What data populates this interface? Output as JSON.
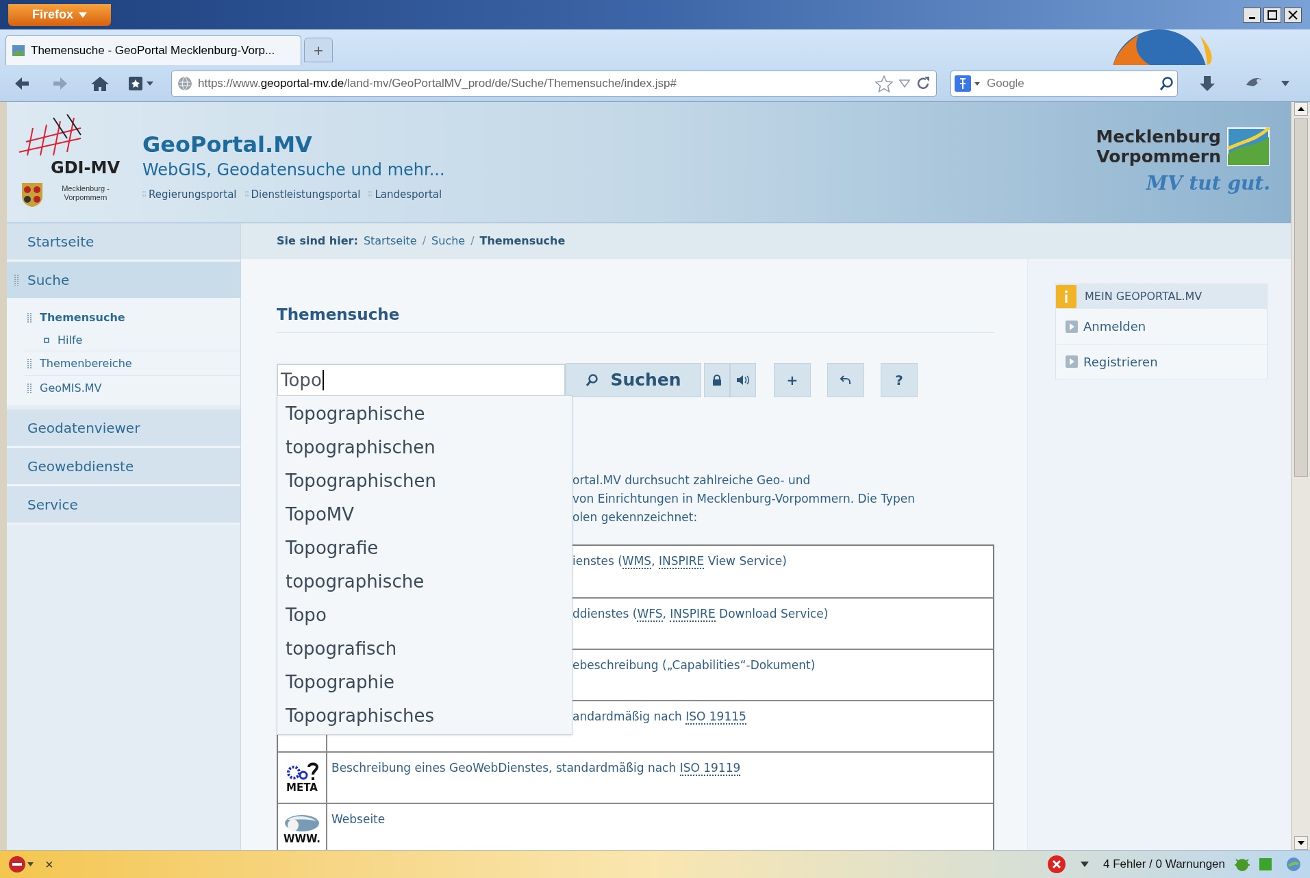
{
  "browser": {
    "menu_button": "Firefox",
    "tab": {
      "title": "Themensuche - GeoPortal Mecklenburg-Vorp...",
      "selected": true
    },
    "new_tab": "+",
    "url": "https://www.**geoportal-mv.de**/land-mv/GeoPortalMV_prod/de/Suche/Themensuche/index.jsp#",
    "search_placeholder": "Google"
  },
  "header": {
    "logo_text": "GDI-MV",
    "logo_subtext": "Mecklenburg - Vorpommern",
    "title": "GeoPortal.MV",
    "subtitle": "WebGIS, Geodatensuche und mehr...",
    "links": [
      "Regierungsportal",
      "Dienstleistungsportal",
      "Landesportal"
    ],
    "state_logo": [
      "Mecklenburg",
      "Vorpommern"
    ],
    "slogan": "MV tut gut."
  },
  "sidebar": {
    "items": [
      {
        "label": "Startseite",
        "expanded": false
      },
      {
        "label": "Suche",
        "expanded": true,
        "children": [
          {
            "label": "Themensuche",
            "selected": true,
            "children": [
              {
                "label": "Hilfe",
                "selected": false
              }
            ]
          },
          {
            "label": "Themenbereiche",
            "selected": false
          },
          {
            "label": "GeoMIS.MV",
            "selected": false
          }
        ]
      },
      {
        "label": "Geodatenviewer",
        "expanded": false
      },
      {
        "label": "Geowebdienste",
        "expanded": false
      },
      {
        "label": "Service",
        "expanded": false
      }
    ]
  },
  "breadcrumb": {
    "label": "Sie sind hier:",
    "separator": "/",
    "items": [
      {
        "label": "Startseite",
        "current": false
      },
      {
        "label": "Suche",
        "current": false
      },
      {
        "label": "Themensuche",
        "current": true
      }
    ]
  },
  "heading": "Themensuche",
  "search": {
    "value": "Topo",
    "button": "Suchen",
    "tools": [
      {
        "kind": "lock"
      },
      {
        "kind": "speaker"
      },
      {
        "kind": "text",
        "label": "+"
      },
      {
        "kind": "undo"
      },
      {
        "kind": "text",
        "label": "?"
      }
    ]
  },
  "suggestions": [
    "Topographische",
    "topographischen",
    "Topographischen",
    "TopoMV",
    "Topografie",
    "topographische",
    "Topo",
    "topografisch",
    "Topographie",
    "Topographisches"
  ],
  "intro_lines": [
    "ortal.MV durchsucht zahlreiche Geo- und",
    "von Einrichtungen in Mecklenburg-Vorpommern. Die Typen",
    "olen gekennzeichnet:"
  ],
  "table_rows": [
    {
      "covered": true,
      "parts": [
        {
          "text": "ienstes ("
        },
        {
          "text": "WMS",
          "abbr": true
        },
        {
          "text": ", "
        },
        {
          "text": "INSPIRE",
          "abbr": true
        },
        {
          "text": " View Service)"
        }
      ]
    },
    {
      "covered": true,
      "parts": [
        {
          "text": "ddienstes ("
        },
        {
          "text": "WFS",
          "abbr": true
        },
        {
          "text": ", "
        },
        {
          "text": "INSPIRE",
          "abbr": true
        },
        {
          "text": " Download Service)"
        }
      ]
    },
    {
      "covered": true,
      "parts": [
        {
          "text": "ebeschreibung („Capabilities“-Dokument)"
        }
      ]
    },
    {
      "covered": true,
      "parts": [
        {
          "text": "andardmäßig nach "
        },
        {
          "text": "ISO 19115",
          "abbr": true
        }
      ]
    },
    {
      "covered": false,
      "kind": "meta",
      "icon_caption": "META",
      "parts": [
        {
          "text": "Beschreibung eines GeoWebDienstes, standardmäßig nach "
        },
        {
          "text": "ISO 19119",
          "abbr": true
        }
      ]
    },
    {
      "covered": false,
      "kind": "www",
      "icon_caption": "WWW.",
      "parts": [
        {
          "text": "Webseite"
        }
      ]
    }
  ],
  "account_box": {
    "title": "MEIN GEOPORTAL.MV",
    "links": [
      "Anmelden",
      "Registrieren"
    ]
  },
  "status_bar": {
    "close": "×",
    "errors": "4 Fehler / 0 Warnungen"
  }
}
